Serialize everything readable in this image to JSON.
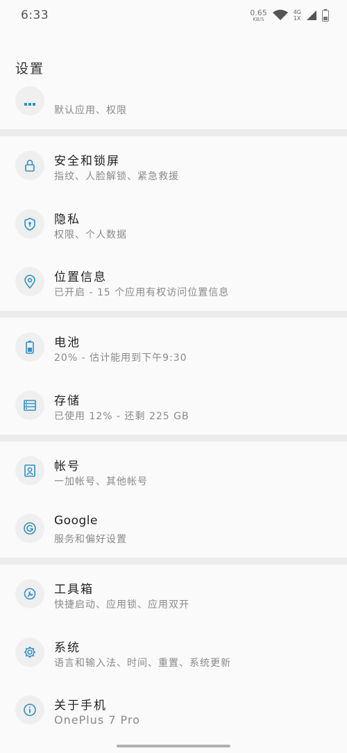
{
  "status_bar": {
    "time": "6:33",
    "speed_value": "0.65",
    "speed_unit": "KB/S",
    "net_top": "4G",
    "net_bottom": "1X",
    "icons": [
      "wifi-icon",
      "signal-icon",
      "battery-icon"
    ]
  },
  "page": {
    "title": "设置"
  },
  "colors": {
    "accent": "#2e90c8",
    "icon_bg": "#efefef",
    "divider": "#ececec"
  },
  "items": [
    {
      "title": "",
      "subtitle": "默认应用、权限",
      "icon": "apps-icon"
    },
    {
      "title": "安全和锁屏",
      "subtitle": "指纹、人脸解锁、紧急救援",
      "icon": "lock-icon"
    },
    {
      "title": "隐私",
      "subtitle": "权限、个人数据",
      "icon": "privacy-shield-icon"
    },
    {
      "title": "位置信息",
      "subtitle": "已开启 - 15 个应用有权访问位置信息",
      "icon": "location-pin-icon"
    },
    {
      "title": "电池",
      "subtitle": "20% - 估计能用到下午9:30",
      "icon": "battery-icon"
    },
    {
      "title": "存储",
      "subtitle": "已使用 12% - 还剩 225 GB",
      "icon": "storage-icon"
    },
    {
      "title": "帐号",
      "subtitle": "一加帐号、其他帐号",
      "icon": "account-icon"
    },
    {
      "title": "Google",
      "subtitle": "服务和偏好设置",
      "icon": "google-icon"
    },
    {
      "title": "工具箱",
      "subtitle": "快捷启动、应用锁、应用双开",
      "icon": "tools-icon"
    },
    {
      "title": "系统",
      "subtitle": "语言和输入法、时间、重置、系统更新",
      "icon": "gear-icon"
    },
    {
      "title": "关于手机",
      "subtitle": "OnePlus 7 Pro",
      "icon": "info-icon"
    }
  ]
}
